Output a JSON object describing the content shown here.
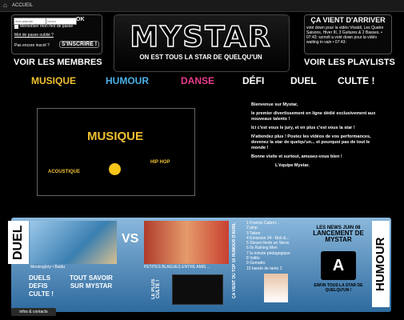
{
  "topbar": {
    "home_label": "ACCUEIL",
    "home_icon": "home-icon"
  },
  "login": {
    "pseudo_value": "mon pseudo",
    "password_value": "••••••••",
    "ok_label": "OK",
    "remember_label": "Mémoriser mon mot de passe",
    "forgot_label": "Mot de passe oublié ?",
    "not_registered": "Pas encore inscrit ?",
    "signup_label": "S'INSCRIRE !"
  },
  "logo": {
    "text": "MYSTAR",
    "slogan": "ON EST TOUS LA STAR DE QUELQU'UN"
  },
  "news": {
    "title": "ÇA VIENT D'ARRIVER",
    "text": "voté down pour la vidéo Vivaldi, Les Quatre Saisons, Hiver III, 3 Guitares & 2 Basses. • 07:43: szmolt a voté down pour la vidéo waiting in vain • 07:43:"
  },
  "nav": {
    "voir_membres": "VOIR LES MEMBRES",
    "voir_playlists": "VOIR LES PLAYLISTS"
  },
  "categories": [
    {
      "label": "MUSIQUE",
      "color": "#f0c030"
    },
    {
      "label": "HUMOUR",
      "color": "#4ab0e8"
    },
    {
      "label": "DANSE",
      "color": "#e83c8c"
    },
    {
      "label": "DÉFI",
      "color": "#ffffff"
    },
    {
      "label": "DUEL",
      "color": "#ffffff"
    },
    {
      "label": "CULTE !",
      "color": "#ffffff"
    }
  ],
  "feature": {
    "title": "MUSIQUE",
    "label_left": "ACOUSTIQUE",
    "label_right": "HIP HOP"
  },
  "welcome": {
    "p1": "Bienvenue sur Mystar,",
    "p2": "le premier divertissement en ligne dédié exclusivement aux nouveaux talents !",
    "p3": "Ici c'est vous le jury, et en plus c'est vous la star !",
    "p4": "N'attendez plus ! Postez les vidéos de vos performances, devenez la star de quelqu'un... et pourquoi pas de tout le monde !",
    "p5": "Bonne visite et surtout, amusez-vous bien !",
    "p6": "L'équipe Mystar."
  },
  "duel": {
    "label": "DUEL",
    "vs": "VS",
    "caption1": "Morsinglory • Baidu",
    "caption2": "PETITES BLAGUES ENTRE AMIS ...",
    "links": [
      "DUELS",
      "DEFIS",
      "CULTE !"
    ],
    "tout_savoir": "TOUT SAVOIR SUR MYSTAR"
  },
  "culte": {
    "label": "LE PLUS CULTE !"
  },
  "top10": {
    "label": "ÇA VIENT DU TOP 10 HUMOUR D'AVRIL",
    "items": [
      "1 Francis Cabrel...",
      "2 plop",
      "3 Takeo",
      "4 Emission 04 - Bob &...",
      "5 Steven fente un Steve",
      "6 Ils Raining Men",
      "7 la minute pédagogique",
      "8 Valtto",
      "9 Gematto",
      "10 bande de tarés 2"
    ]
  },
  "news2": {
    "title": "LES NEWS JUIN 08",
    "subtitle": "LANCEMENT DE MYSTAR",
    "logo": "A",
    "caption": "ENFIN TOUS LA STAR DE QUELQU'UN !"
  },
  "humour": {
    "label": "HUMOUR"
  },
  "footer": {
    "infos_label": "infos & contacts"
  }
}
